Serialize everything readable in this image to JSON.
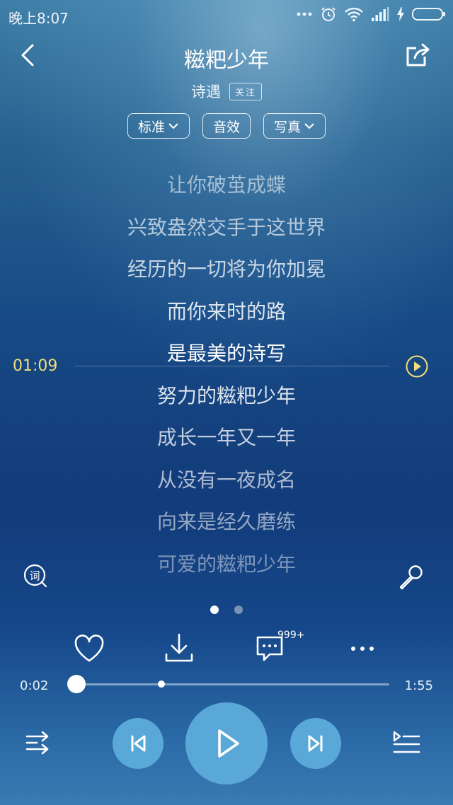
{
  "status_bar": {
    "time": "晚上8:07",
    "icons": [
      "more-dots-icon",
      "alarm-icon",
      "wifi-icon",
      "signal-icon",
      "charging-icon",
      "battery-icon"
    ]
  },
  "header": {
    "title": "糍粑少年",
    "artist": "诗遇",
    "follow_label": "关注"
  },
  "options": {
    "quality_label": "标准",
    "effects_label": "音效",
    "photo_label": "写真"
  },
  "lyrics": [
    "让你破茧成蝶",
    "兴致盎然交手于这世界",
    "经历的一切将为你加冕",
    "而你来时的路",
    "是最美的诗写",
    "努力的糍粑少年",
    "成长一年又一年",
    "从没有一夜成名",
    "向来是经久磨练",
    "可爱的糍粑少年"
  ],
  "current_lyric_index": 4,
  "lyric_time_marker": "01:09",
  "page_indicator": {
    "count": 2,
    "active": 0
  },
  "actions": {
    "comment_badge": "999+"
  },
  "progress": {
    "current": "0:02",
    "total": "1:55",
    "fraction": 0.017
  },
  "colors": {
    "accent_time": "#f0df7a",
    "control_button": "#5aa8d8",
    "dot_active": "#ffffff",
    "dot_inactive": "#7d93b3"
  }
}
